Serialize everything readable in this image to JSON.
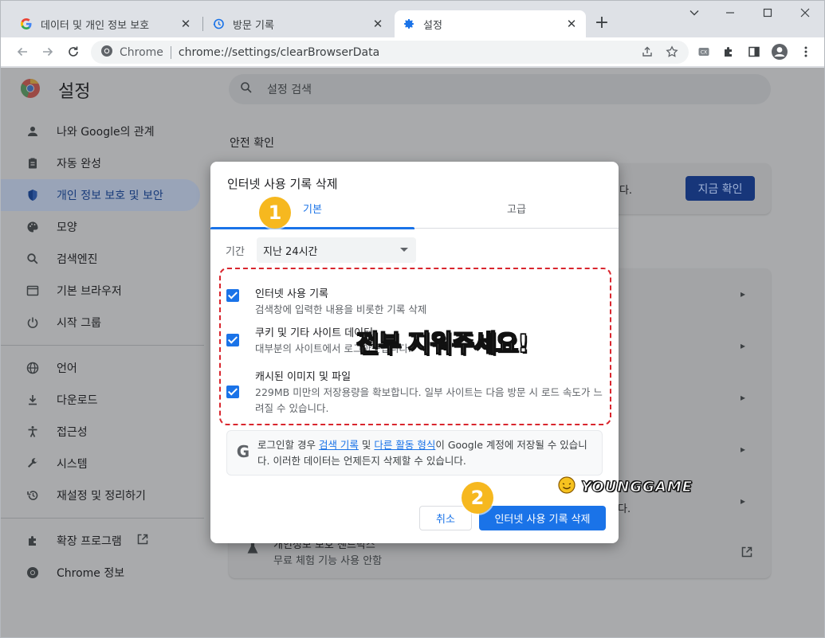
{
  "tabs": [
    {
      "title": "데이터 및 개인 정보 보호",
      "icon": "google-g-icon"
    },
    {
      "title": "방문 기록",
      "icon": "history-icon"
    },
    {
      "title": "설정",
      "icon": "gear-icon"
    }
  ],
  "omnibox": {
    "scheme": "Chrome",
    "url": "chrome://settings/clearBrowserData"
  },
  "settings": {
    "title": "설정",
    "search_placeholder": "설정 검색",
    "nav": [
      {
        "label": "나와 Google의 관계",
        "icon": "person-icon"
      },
      {
        "label": "자동 완성",
        "icon": "clipboard-icon"
      },
      {
        "label": "개인 정보 보호 및 보안",
        "icon": "shield-icon"
      },
      {
        "label": "모양",
        "icon": "palette-icon"
      },
      {
        "label": "검색엔진",
        "icon": "search-icon"
      },
      {
        "label": "기본 브라우저",
        "icon": "browser-icon"
      },
      {
        "label": "시작 그룹",
        "icon": "power-icon"
      },
      {
        "label": "언어",
        "icon": "globe-icon"
      },
      {
        "label": "다운로드",
        "icon": "download-icon"
      },
      {
        "label": "접근성",
        "icon": "accessibility-icon"
      },
      {
        "label": "시스템",
        "icon": "wrench-icon"
      },
      {
        "label": "재설정 및 정리하기",
        "icon": "restore-icon"
      },
      {
        "label": "확장 프로그램",
        "icon": "puzzle-icon"
      },
      {
        "label": "Chrome 정보",
        "icon": "chrome-icon"
      }
    ],
    "safety_check_title": "안전 확인",
    "safety_check_button": "지금 확인",
    "peek_card1_tail": "니다.",
    "peek_card2_tail": "다.",
    "sandbox_title": "개인정보 보호 샌드박스",
    "sandbox_desc": "무료 체험 기능 사용 안함"
  },
  "dialog": {
    "title": "인터넷 사용 기록 삭제",
    "tab_basic": "기본",
    "tab_advanced": "고급",
    "period_label": "기간",
    "period_value": "지난 24시간",
    "options": [
      {
        "title": "인터넷 사용 기록",
        "desc": "검색창에 입력한 내용을 비롯한 기록 삭제",
        "checked": true
      },
      {
        "title": "쿠키 및 기타 사이트 데이터",
        "desc": "대부분의 사이트에서 로그아웃됩니다.",
        "checked": true
      },
      {
        "title": "캐시된 이미지 및 파일",
        "desc": "229MB 미만의 저장용량을 확보합니다. 일부 사이트는 다음 방문 시 로드 속도가 느려질 수 있습니다.",
        "checked": true
      }
    ],
    "google_notice": {
      "pre": "로그인할 경우 ",
      "link1": "검색 기록",
      "mid": " 및 ",
      "link2": "다른 활동 형식",
      "post": "이 Google 계정에 저장될 수 있습니다. 이러한 데이터는 언제든지 삭제할 수 있습니다."
    },
    "cancel": "취소",
    "delete": "인터넷 사용 기록 삭제"
  },
  "annotations": {
    "step1": "1",
    "step2": "2",
    "callout": "전부 지워주세요!",
    "watermark": "YOUNGGAME"
  },
  "colors": {
    "accent": "#1a73e8",
    "highlight": "#d9262e",
    "badge": "#f6b81f"
  }
}
